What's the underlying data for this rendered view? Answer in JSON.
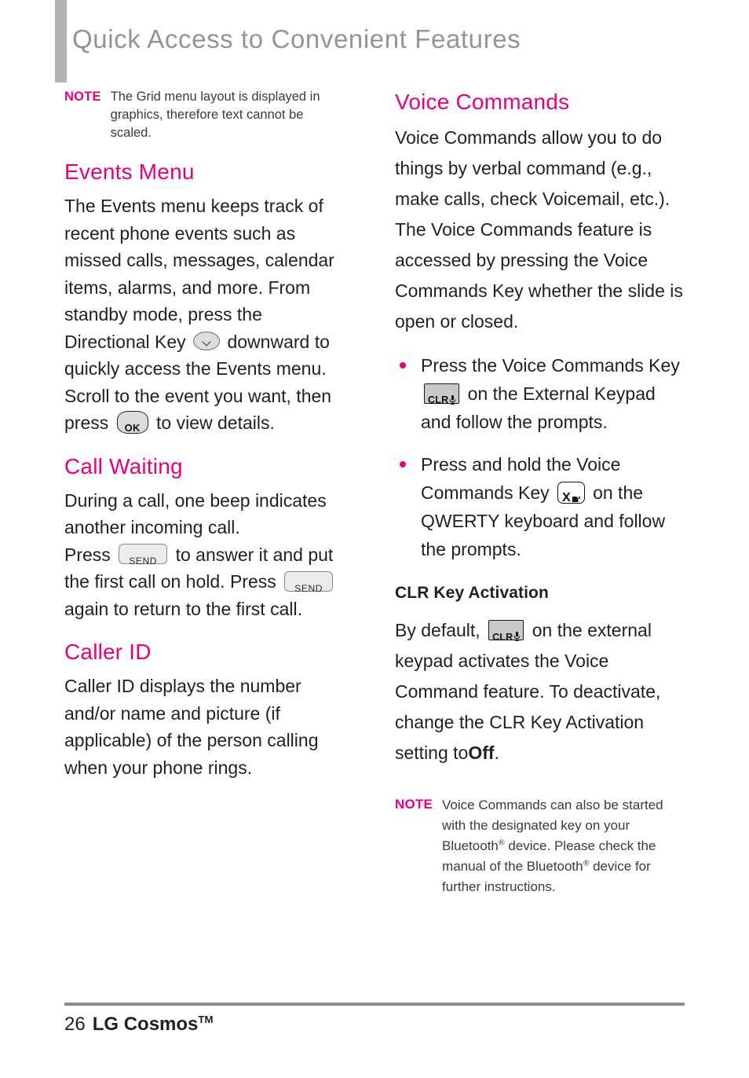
{
  "page": {
    "title": "Quick Access to Convenient Features",
    "accent_color": "#e6007e",
    "header_bar_color": "#b3b3b3",
    "title_color": "#949494"
  },
  "left_column": {
    "note": {
      "label": "NOTE",
      "text": "The Grid menu layout is displayed in graphics, therefore text cannot be scaled."
    },
    "events_menu": {
      "heading": "Events Menu",
      "text_part1": "The Events menu keeps track of recent phone events such as missed calls, messages, calendar items, alarms, and more.  From standby mode, press the Directional Key",
      "text_part2": "downward to quickly access the Events menu. Scroll to the event you want, then press",
      "text_part3": "to view details.",
      "directional_key_icon": "directional-down-key-icon",
      "ok_key_label": "OK"
    },
    "call_waiting": {
      "heading": "Call Waiting",
      "text_part1": "During a call, one beep indicates another incoming call.",
      "text_part2": "Press",
      "text_part3": "to answer it and put the first call on hold. Press",
      "text_part4": "again to return to the first call.",
      "send_key_label": "SEND"
    },
    "caller_id": {
      "heading": "Caller ID",
      "text": "Caller ID displays the number and/or name and picture (if applicable) of the person calling when your phone rings."
    }
  },
  "right_column": {
    "voice_commands": {
      "heading": "Voice Commands",
      "intro": "Voice Commands allow you to do things by verbal command (e.g., make calls, check Voicemail, etc.). The Voice Commands feature is accessed by pressing the Voice Commands Key whether the slide is open or closed.",
      "bullets": [
        {
          "text_part1": "Press the Voice Commands Key",
          "text_part2": "on the External Keypad and follow the prompts.",
          "key_label": "CLR",
          "key_icon": "clr-voice-command-key-icon"
        },
        {
          "text_part1": "Press and hold the Voice Commands Key",
          "text_part2": "on the QWERTY keyboard and follow the prompts.",
          "key_label": "X",
          "key_icon": "x-voice-command-key-icon"
        }
      ]
    },
    "clr_key_activation": {
      "heading": "CLR Key Activation",
      "text_part1": "By default,",
      "text_part2": "on the external keypad activates the Voice Command feature. To deactivate, change the CLR Key Activation setting to",
      "emphasis": "Off",
      "text_part3": ".",
      "key_label": "CLR"
    },
    "note": {
      "label": "NOTE",
      "text_part1": "Voice Commands can also be started with the designated key on your Bluetooth",
      "reg1": "®",
      "text_part2": " device. Please check the manual of the Bluetooth",
      "reg2": "®",
      "text_part3": " device for further instructions."
    }
  },
  "footer": {
    "page_number": "26",
    "brand": "LG Cosmos",
    "trademark": "TM"
  }
}
